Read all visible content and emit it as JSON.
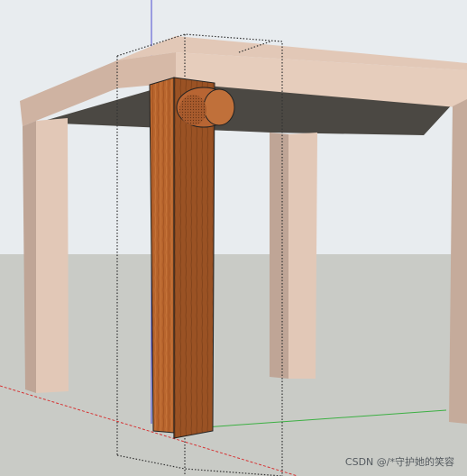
{
  "app": {
    "watermark": "CSDN @/*守护她的笑容"
  },
  "scene": {
    "colors": {
      "sky": "#e8ecef",
      "ground": "#c9cbc6",
      "table_light": "#e2c8b7",
      "table_side": "#bfa596",
      "table_shadow": "#4b4843",
      "leg_wood": "#b8652d",
      "leg_wood_dark": "#8f4a1f",
      "tenon": "#b86533",
      "axis_red": "#d63333",
      "axis_green": "#3cb043",
      "axis_blue": "#4b4bd2",
      "dotted_outline": "#333333"
    },
    "objects": [
      "table-top",
      "table-leg-left",
      "table-leg-middle",
      "table-leg-right",
      "wooden-leg-selected",
      "round-tenon",
      "selection-box"
    ]
  }
}
